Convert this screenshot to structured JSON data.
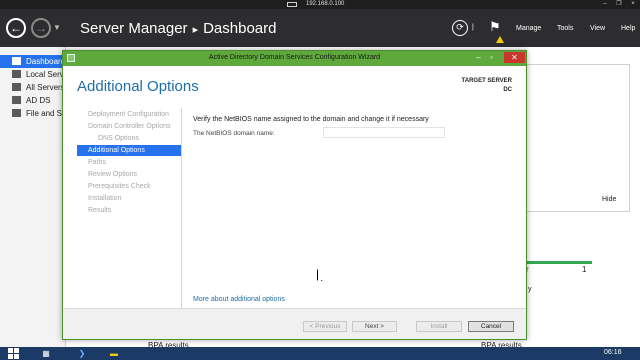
{
  "remote": {
    "host": "192.168.0.100"
  },
  "server_manager": {
    "title": "Server Manager",
    "section": "Dashboard",
    "menus": [
      "Manage",
      "Tools",
      "View",
      "Help"
    ]
  },
  "sidebar": {
    "items": [
      {
        "label": "Dashboard",
        "icon": "dashboard-icon"
      },
      {
        "label": "Local Server",
        "icon": "server-icon"
      },
      {
        "label": "All Servers",
        "icon": "servers-icon"
      },
      {
        "label": "AD DS",
        "icon": "ad-ds-icon"
      },
      {
        "label": "File and Storage Services",
        "icon": "file-storage-icon"
      }
    ]
  },
  "background": {
    "hide_label": "Hide",
    "tile_count": "1",
    "bpa_results": "BPA results"
  },
  "wizard": {
    "title": "Active Directory Domain Services Configuration Wizard",
    "heading": "Additional Options",
    "target_label": "TARGET SERVER",
    "target_name": "DC",
    "steps": [
      "Deployment Configuration",
      "Domain Controller Options",
      "DNS Options",
      "Additional Options",
      "Paths",
      "Review Options",
      "Prerequisites Check",
      "Installation",
      "Results"
    ],
    "instruction": "Verify the NetBIOS name assigned to the domain and change it if necessary",
    "netbios_label": "The NetBIOS domain name:",
    "netbios_value": "",
    "more_link": "More about additional options",
    "buttons": {
      "previous": "< Previous",
      "next": "Next >",
      "install": "Install",
      "cancel": "Cancel"
    }
  },
  "taskbar": {
    "clock": "06:16"
  }
}
